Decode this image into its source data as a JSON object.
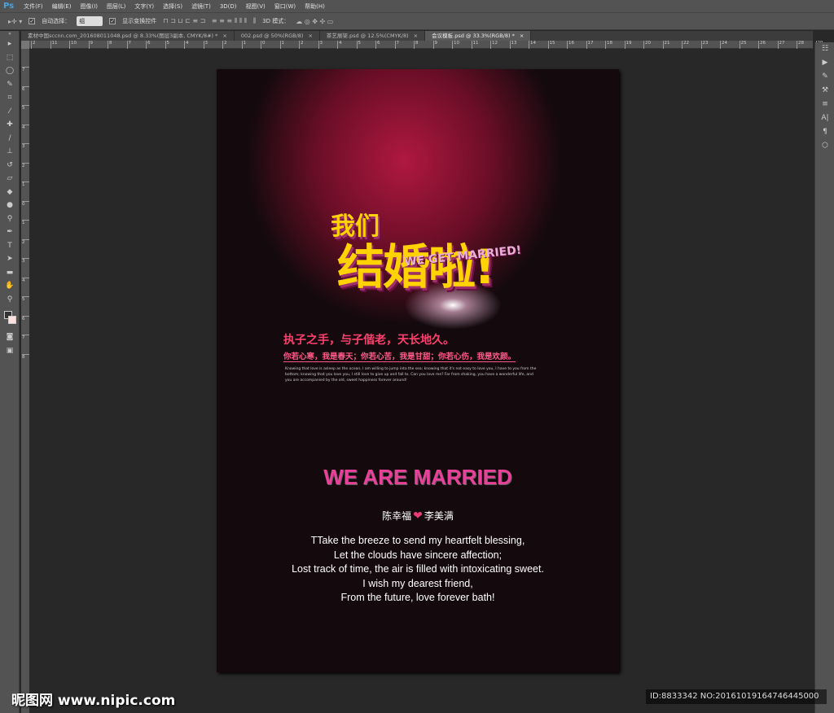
{
  "menubar": {
    "logo": "Ps",
    "items": [
      "文件(F)",
      "编辑(E)",
      "图像(I)",
      "图层(L)",
      "文字(Y)",
      "选择(S)",
      "滤镜(T)",
      "3D(D)",
      "视图(V)",
      "窗口(W)",
      "帮助(H)"
    ]
  },
  "options": {
    "auto_select_label": "自动选择：",
    "auto_select_value": "组",
    "show_transform_label": "显示变换控件",
    "mode_3d_label": "3D 模式："
  },
  "tabs": [
    {
      "label": "素材中国sccnn.com_201608011048.psd @ 8.33%(图层3副本, CMYK/8#) *",
      "active": false
    },
    {
      "label": "002.psd @ 50%(RGB/8)",
      "active": false
    },
    {
      "label": "茶艺展架.psd @ 12.5%(CMYK/8)",
      "active": false
    },
    {
      "label": "会议模板.psd @ 33.3%(RGB/8) *",
      "active": true
    }
  ],
  "ruler": {
    "h": [
      "2",
      "11",
      "10",
      "9",
      "8",
      "7",
      "6",
      "5",
      "4",
      "3",
      "2",
      "1",
      "0",
      "1",
      "2",
      "3",
      "4",
      "5",
      "6",
      "7",
      "8",
      "9",
      "10",
      "11",
      "12",
      "13",
      "14",
      "15",
      "16",
      "17",
      "18",
      "19",
      "20",
      "21",
      "22",
      "23",
      "24",
      "25",
      "26",
      "27",
      "28",
      "29"
    ],
    "v": [
      "7",
      "6",
      "5",
      "4",
      "3",
      "2",
      "1",
      "0",
      "1",
      "2",
      "3",
      "4",
      "5",
      "6",
      "7",
      "8"
    ]
  },
  "poster": {
    "title_small": "我们",
    "title_big": "结婚啦!",
    "title_en": "WE GET MARRIED!",
    "line1": "执子之手，与子偕老，天长地久。",
    "line2": "你若心寒，我是春天；你若心苦，我是甘甜；你若心伤，我是欢颜。",
    "small_text": "Knowing that love is asleep as the ocean, I am willing to jump into the sea; knowing that it's not easy to love you, I have to you from the bottom; knowing that you love you, I still love to give up and fall to. Can you love me? Far from shaking, you have a wonderful life, and you are accompanied by the old, sweet happiness forever around!",
    "married": "WE ARE MARRIED",
    "groom": "陈幸福",
    "bride": "李美满",
    "verses": [
      "TTake the breeze to send my heartfelt blessing,",
      "Let the clouds have sincere affection;",
      "Lost track of time, the air is filled with intoxicating sweet.",
      "I wish my dearest friend,",
      "From the future, love forever bath!"
    ]
  },
  "watermark": {
    "left": "昵图网 www.nipic.com",
    "right": "ID:8833342 NO:20161019164746445000"
  }
}
